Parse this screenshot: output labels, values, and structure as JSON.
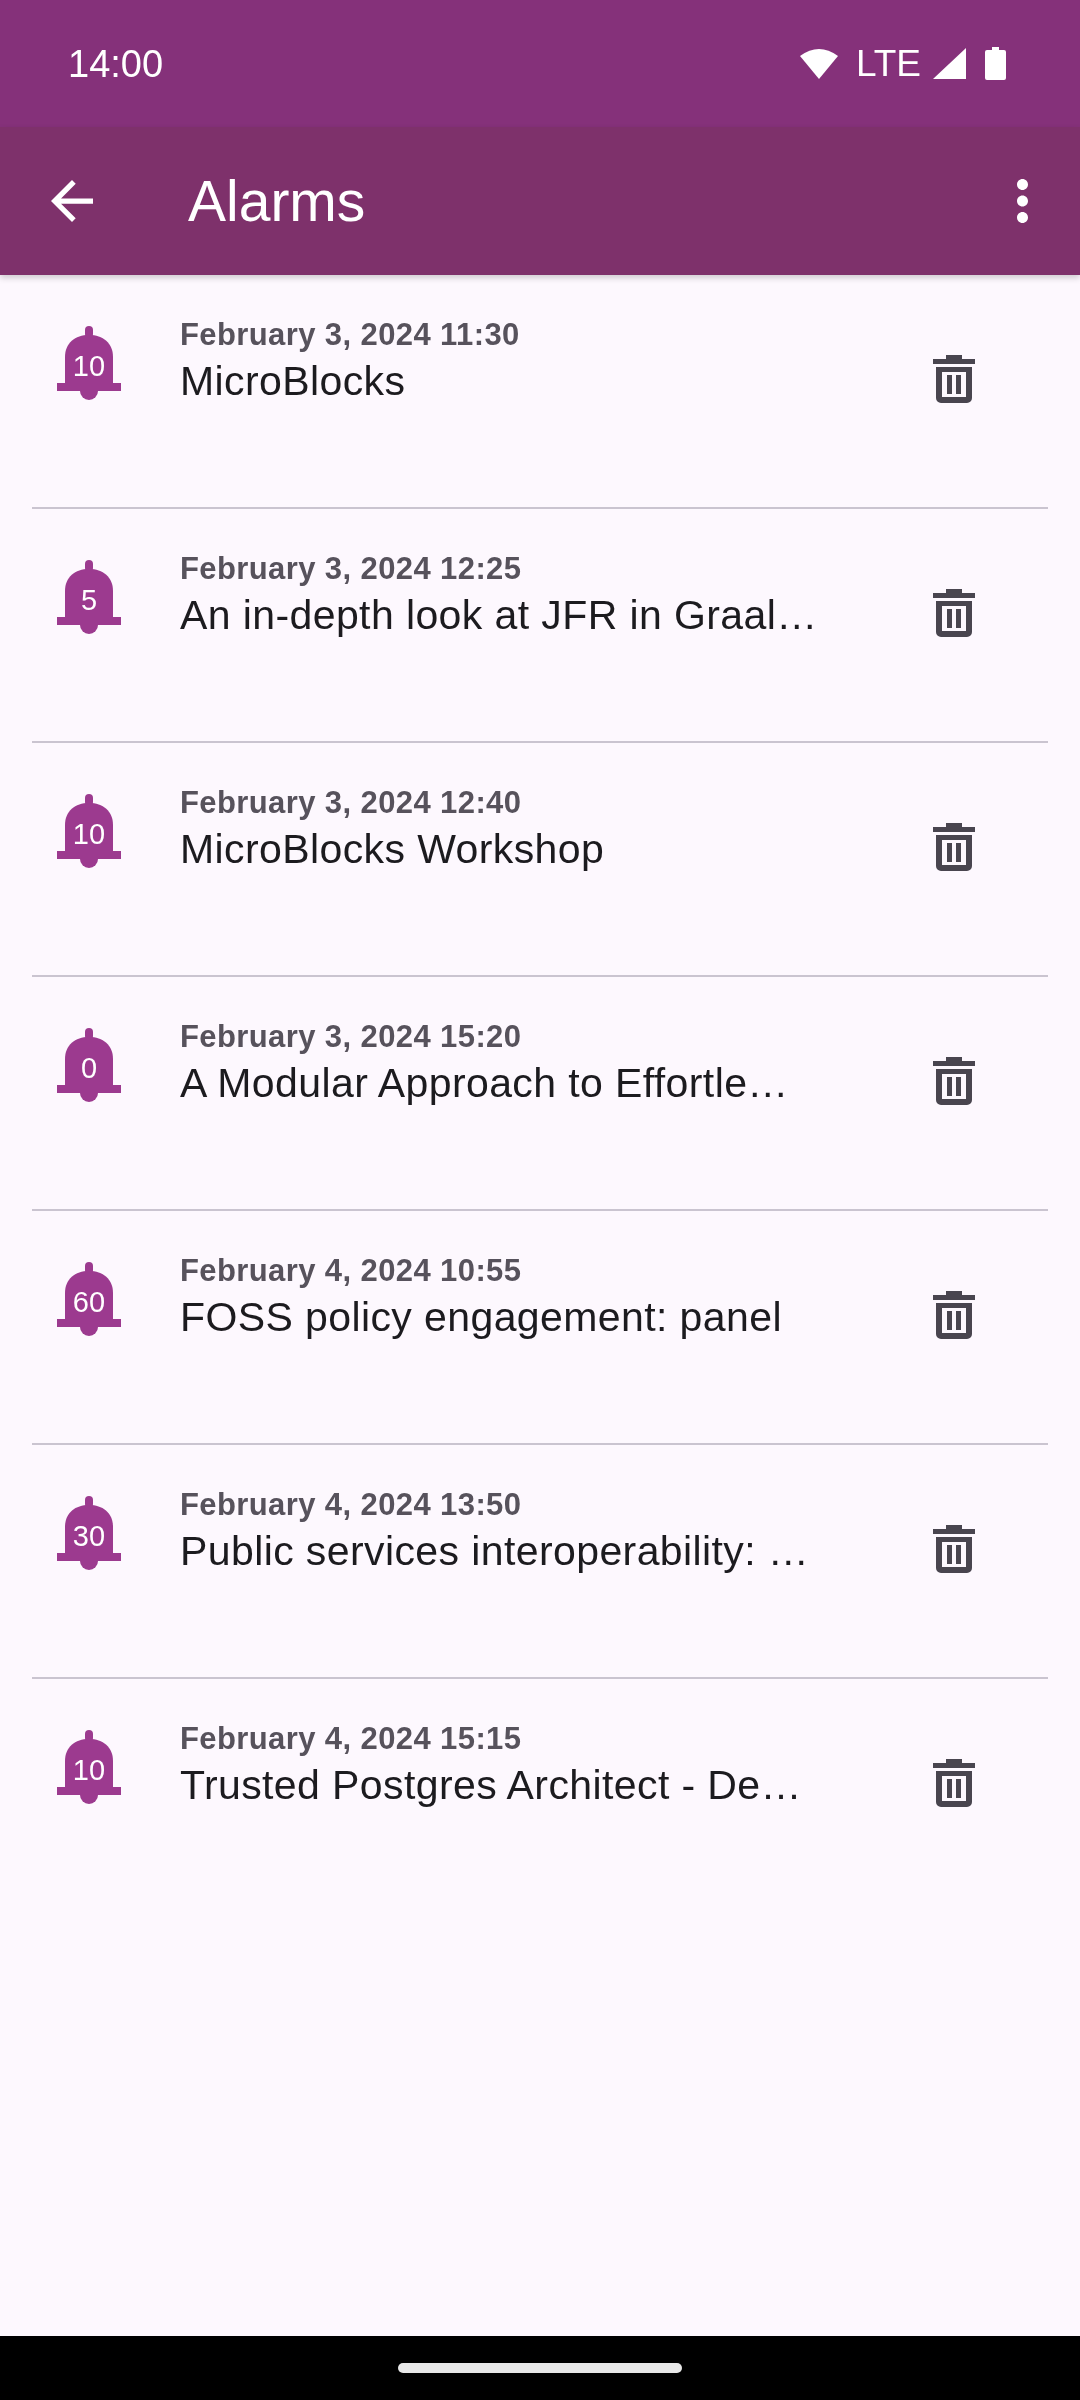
{
  "status_bar": {
    "time": "14:00",
    "network": "LTE"
  },
  "app_bar": {
    "title": "Alarms"
  },
  "alarms": [
    {
      "reminder": "10",
      "date": "February 3, 2024 11:30",
      "title": "MicroBlocks"
    },
    {
      "reminder": "5",
      "date": "February 3, 2024 12:25",
      "title": "An in-depth look at JFR in Graal…"
    },
    {
      "reminder": "10",
      "date": "February 3, 2024 12:40",
      "title": "MicroBlocks Workshop"
    },
    {
      "reminder": "0",
      "date": "February 3, 2024 15:20",
      "title": "A Modular Approach to Effortle…"
    },
    {
      "reminder": "60",
      "date": "February 4, 2024 10:55",
      "title": "FOSS policy engagement: panel"
    },
    {
      "reminder": "30",
      "date": "February 4, 2024 13:50",
      "title": "Public services interoperability: …"
    },
    {
      "reminder": "10",
      "date": "February 4, 2024 15:15",
      "title": "Trusted Postgres Architect - De…"
    }
  ]
}
